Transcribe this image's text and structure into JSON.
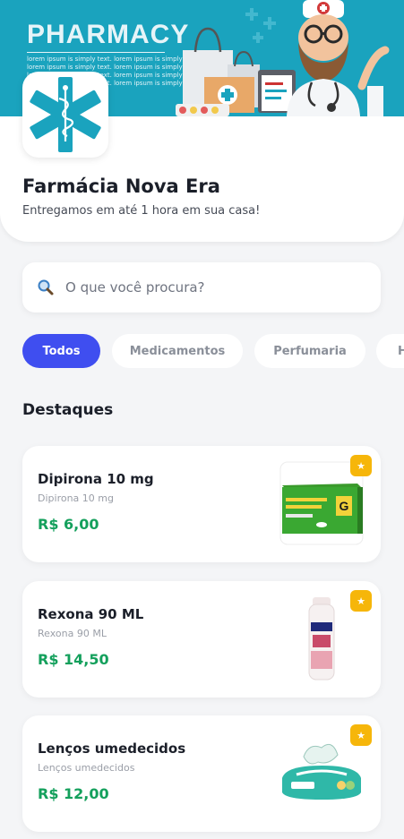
{
  "banner": {
    "title": "PHARMACY",
    "lines": [
      "lorem ipsum is simply text. lorem ipsum is simply text.",
      "lorem ipsum is simply text. lorem ipsum is simply text.",
      "lorem ipsum is simply text. lorem ipsum is simply text.",
      "lorem ipsum is simply text. lorem ipsum is simply text."
    ]
  },
  "store": {
    "name": "Farmácia Nova Era",
    "tagline": "Entregamos em até 1 hora em sua casa!",
    "logo_icon": "star-of-life-icon"
  },
  "search": {
    "placeholder": "O que você procura?",
    "value": "",
    "icon": "search-icon"
  },
  "categories": [
    {
      "label": "Todos",
      "active": true
    },
    {
      "label": "Medicamentos",
      "active": false
    },
    {
      "label": "Perfumaria",
      "active": false
    },
    {
      "label": "H",
      "active": false
    }
  ],
  "section": {
    "title": "Destaques"
  },
  "products": [
    {
      "name": "Dipirona 10 mg",
      "subtitle": "Dipirona 10 mg",
      "price": "R$ 6,00",
      "image": "medicine-box-image",
      "badge_icon": "star-icon",
      "badge": "★"
    },
    {
      "name": "Rexona 90 ML",
      "subtitle": "Rexona 90 ML",
      "price": "R$ 14,50",
      "image": "deodorant-can-image",
      "badge_icon": "star-icon",
      "badge": "★"
    },
    {
      "name": "Lenços umedecidos",
      "subtitle": "Lenços umedecidos",
      "price": "R$ 12,00",
      "image": "wet-wipes-pack-image",
      "badge_icon": "star-icon",
      "badge": "★"
    }
  ],
  "colors": {
    "accent": "#3f4ef0",
    "price": "#14a05c",
    "banner": "#1aa3be",
    "badge": "#f6b60a"
  }
}
